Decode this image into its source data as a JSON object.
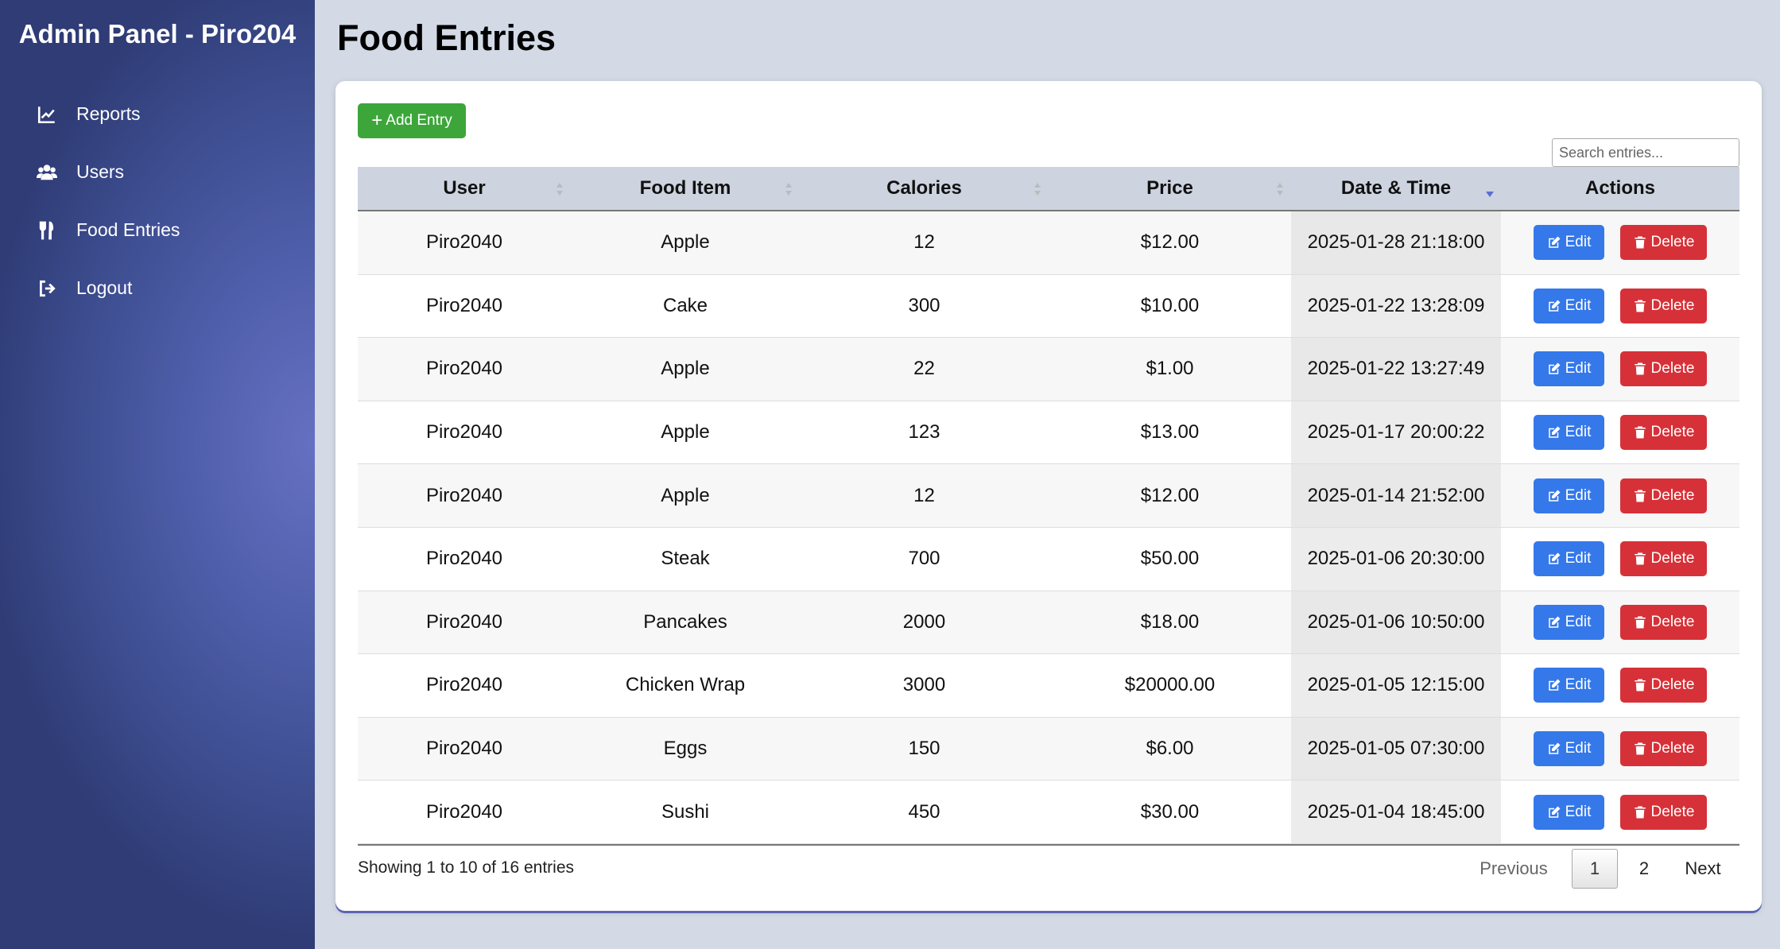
{
  "sidebar": {
    "title": "Admin Panel - Piro204",
    "items": [
      {
        "label": "Reports",
        "icon": "chart-line-icon"
      },
      {
        "label": "Users",
        "icon": "users-icon"
      },
      {
        "label": "Food Entries",
        "icon": "utensils-icon"
      },
      {
        "label": "Logout",
        "icon": "sign-out-icon"
      }
    ]
  },
  "main": {
    "title": "Food Entries",
    "add_button": "Add Entry",
    "search_placeholder": "Search entries...",
    "columns": [
      "User",
      "Food Item",
      "Calories",
      "Price",
      "Date & Time",
      "Actions"
    ],
    "sorted_column": "Date & Time",
    "sort_direction": "desc",
    "edit_label": "Edit",
    "delete_label": "Delete",
    "rows": [
      {
        "user": "Piro2040",
        "food": "Apple",
        "calories": "12",
        "price": "$12.00",
        "datetime": "2025-01-28 21:18:00"
      },
      {
        "user": "Piro2040",
        "food": "Cake",
        "calories": "300",
        "price": "$10.00",
        "datetime": "2025-01-22 13:28:09"
      },
      {
        "user": "Piro2040",
        "food": "Apple",
        "calories": "22",
        "price": "$1.00",
        "datetime": "2025-01-22 13:27:49"
      },
      {
        "user": "Piro2040",
        "food": "Apple",
        "calories": "123",
        "price": "$13.00",
        "datetime": "2025-01-17 20:00:22"
      },
      {
        "user": "Piro2040",
        "food": "Apple",
        "calories": "12",
        "price": "$12.00",
        "datetime": "2025-01-14 21:52:00"
      },
      {
        "user": "Piro2040",
        "food": "Steak",
        "calories": "700",
        "price": "$50.00",
        "datetime": "2025-01-06 20:30:00"
      },
      {
        "user": "Piro2040",
        "food": "Pancakes",
        "calories": "2000",
        "price": "$18.00",
        "datetime": "2025-01-06 10:50:00"
      },
      {
        "user": "Piro2040",
        "food": "Chicken Wrap",
        "calories": "3000",
        "price": "$20000.00",
        "datetime": "2025-01-05 12:15:00"
      },
      {
        "user": "Piro2040",
        "food": "Eggs",
        "calories": "150",
        "price": "$6.00",
        "datetime": "2025-01-05 07:30:00"
      },
      {
        "user": "Piro2040",
        "food": "Sushi",
        "calories": "450",
        "price": "$30.00",
        "datetime": "2025-01-04 18:45:00"
      }
    ],
    "info": "Showing 1 to 10 of 16 entries",
    "pagination": {
      "previous": "Previous",
      "pages": [
        "1",
        "2"
      ],
      "current": "1",
      "next": "Next"
    }
  },
  "colors": {
    "add_button": "#3ca63a",
    "edit_button": "#3478ea",
    "delete_button": "#d63138",
    "background": "#d3dae6"
  }
}
